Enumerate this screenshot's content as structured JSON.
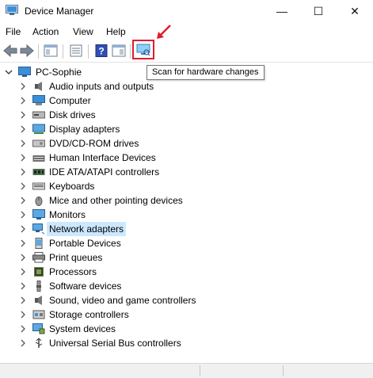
{
  "window": {
    "title": "Device Manager",
    "minimize_glyph": "—",
    "maximize_glyph": "☐",
    "close_glyph": "✕"
  },
  "menu": [
    "File",
    "Action",
    "View",
    "Help"
  ],
  "toolbar": {
    "scan_tooltip": "Scan for hardware changes"
  },
  "tree": {
    "root": "PC-Sophie",
    "items": [
      {
        "label": "Audio inputs and outputs",
        "icon": "speaker-icon"
      },
      {
        "label": "Computer",
        "icon": "computer-icon"
      },
      {
        "label": "Disk drives",
        "icon": "disk-drive-icon"
      },
      {
        "label": "Display adapters",
        "icon": "display-adapter-icon"
      },
      {
        "label": "DVD/CD-ROM drives",
        "icon": "dvd-drive-icon"
      },
      {
        "label": "Human Interface Devices",
        "icon": "hid-icon"
      },
      {
        "label": "IDE ATA/ATAPI controllers",
        "icon": "ide-controller-icon"
      },
      {
        "label": "Keyboards",
        "icon": "keyboard-icon"
      },
      {
        "label": "Mice and other pointing devices",
        "icon": "mouse-icon"
      },
      {
        "label": "Monitors",
        "icon": "monitor-icon"
      },
      {
        "label": "Network adapters",
        "icon": "network-adapter-icon",
        "selected": true
      },
      {
        "label": "Portable Devices",
        "icon": "portable-device-icon"
      },
      {
        "label": "Print queues",
        "icon": "printer-icon"
      },
      {
        "label": "Processors",
        "icon": "processor-icon"
      },
      {
        "label": "Software devices",
        "icon": "software-device-icon"
      },
      {
        "label": "Sound, video and game controllers",
        "icon": "sound-controller-icon"
      },
      {
        "label": "Storage controllers",
        "icon": "storage-controller-icon"
      },
      {
        "label": "System devices",
        "icon": "system-device-icon"
      },
      {
        "label": "Universal Serial Bus controllers",
        "icon": "usb-icon"
      }
    ]
  },
  "colors": {
    "highlight_box": "#e11d2a",
    "selection": "#cce8ff"
  }
}
